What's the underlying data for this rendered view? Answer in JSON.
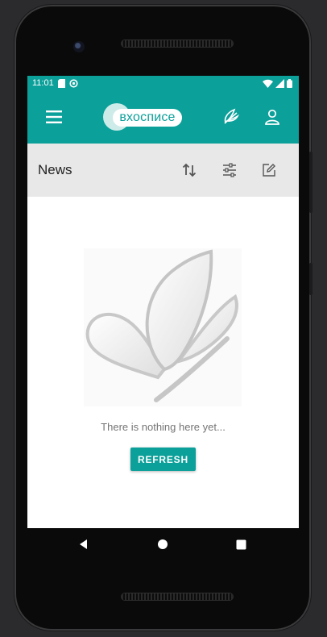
{
  "status_bar": {
    "time": "11:01",
    "left_icons": [
      "sd-card-icon",
      "sync-icon"
    ],
    "right_icons": [
      "wifi-icon",
      "signal-icon",
      "battery-icon"
    ]
  },
  "app_bar": {
    "brand_text": "вхосписе",
    "accent_color": "#0ca09a",
    "icons": [
      "menu-icon",
      "butterfly-icon",
      "profile-icon"
    ]
  },
  "section_toolbar": {
    "title": "News",
    "icons": [
      "sort-icon",
      "filter-icon",
      "edit-icon"
    ]
  },
  "empty_state": {
    "message": "There is nothing here yet...",
    "refresh_label": "REFRESH",
    "illustration": "butterfly-illustration"
  },
  "nav_bar": {
    "icons": [
      "back-icon",
      "home-icon",
      "recents-icon"
    ]
  }
}
